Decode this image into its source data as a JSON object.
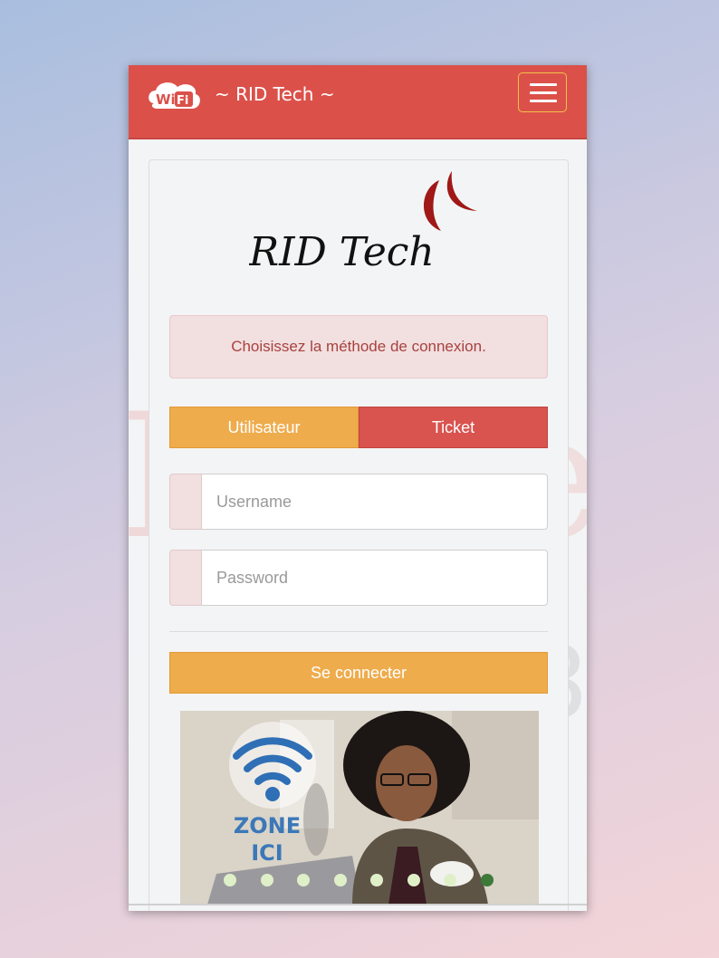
{
  "navbar": {
    "wifi_logo_text": "Wi Fi",
    "brand": "~ RID Tech ~"
  },
  "logo": {
    "text": "RID  Tech"
  },
  "alert": {
    "message": "Choisissez la méthode de connexion."
  },
  "tabs": [
    {
      "label": "Utilisateur",
      "active": true
    },
    {
      "label": "Ticket",
      "active": false
    }
  ],
  "form": {
    "username_placeholder": "Username",
    "password_placeholder": "Password",
    "submit_label": "Se connecter"
  },
  "banner": {
    "zone_line1": "ZONE",
    "zone_line2": "ICI",
    "slide_count": 8,
    "active_slide": 8
  },
  "colors": {
    "navbar": "#db514a",
    "accent_orange": "#eeac4c",
    "accent_red": "#d9534f",
    "alert_bg": "#f2dfe0",
    "alert_text": "#a7423e"
  }
}
